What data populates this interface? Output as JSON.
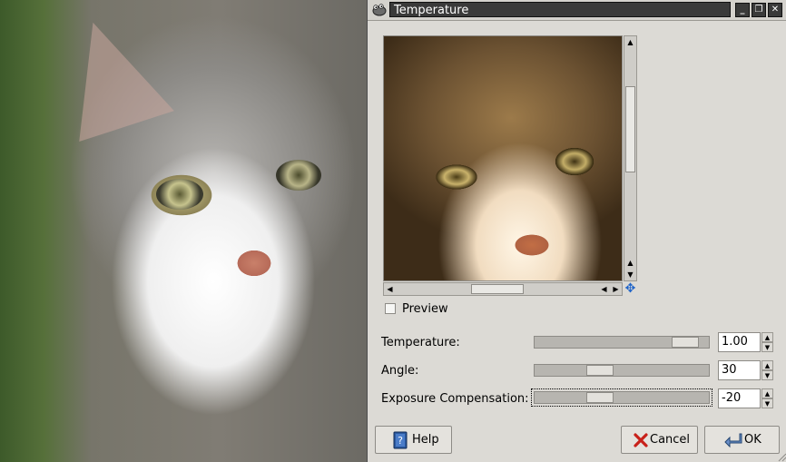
{
  "background": {
    "description_icon": "cat-photo"
  },
  "window": {
    "title": "Temperature",
    "title_icon": "gimp-wilber-icon",
    "buttons": {
      "minimize": "_",
      "restore": "❐",
      "close": "✕"
    }
  },
  "preview": {
    "checkbox_label": "Preview",
    "checked": false,
    "navigate_icon": "navigate-icon"
  },
  "params": [
    {
      "label": "Temperature:",
      "value": "1.00",
      "slider_fraction": 0.93
    },
    {
      "label": "Angle:",
      "value": "30",
      "slider_fraction": 0.35
    },
    {
      "label": "Exposure Compensation:",
      "value": "-20",
      "slider_fraction": 0.35
    }
  ],
  "buttons": {
    "help": "Help",
    "cancel": "Cancel",
    "ok": "OK"
  },
  "colors": {
    "dialog_bg": "#dcdad5",
    "titlebar_text_bg": "#3a3a3a",
    "slider_track": "#b7b5b0"
  }
}
